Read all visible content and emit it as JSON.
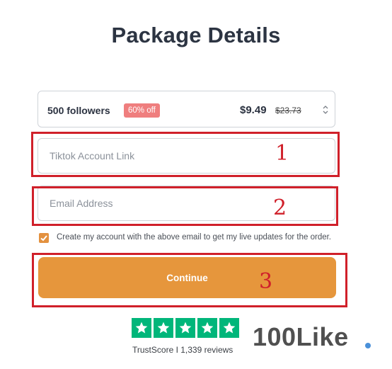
{
  "page": {
    "title": "Package Details"
  },
  "package": {
    "label": "500 followers",
    "discount": "60% off",
    "price": "$9.49",
    "old_price": "$23.73"
  },
  "fields": {
    "tiktok_placeholder": "Tiktok Account Link",
    "email_placeholder": "Email Address"
  },
  "checkbox": {
    "checked": true,
    "label": "Create my account with the above email to get my live updates for the order."
  },
  "continue_label": "Continue",
  "annotations": [
    "1",
    "2",
    "3"
  ],
  "trustpilot": {
    "stars": 5,
    "text": "TrustScore I 1,339 reviews",
    "color": "#00b67a"
  },
  "brand": {
    "logo_text": "100Like",
    "accent": "#e6963c"
  }
}
